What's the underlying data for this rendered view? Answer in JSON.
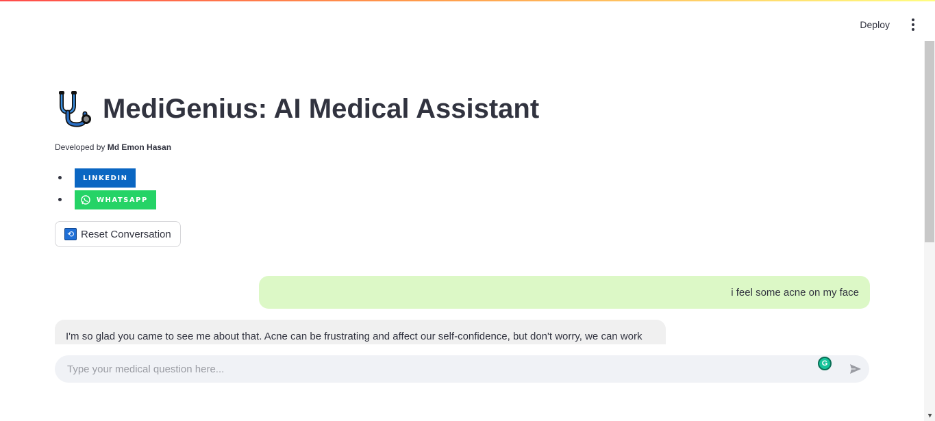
{
  "header": {
    "deploy_label": "Deploy",
    "menu_icon": "more-vertical-icon"
  },
  "app": {
    "title": "MediGenius: AI Medical Assistant",
    "title_icon": "stethoscope-icon",
    "developer_prefix": "Developed by ",
    "developer_name": "Md Emon Hasan"
  },
  "links": [
    {
      "label": "LINKEDIN",
      "color": "#0a66c2"
    },
    {
      "label": "WHATSAPP",
      "color": "#25d366",
      "icon": "whatsapp-icon"
    }
  ],
  "reset_button": {
    "label": "Reset Conversation",
    "icon": "repeat-icon"
  },
  "chat": {
    "messages": [
      {
        "role": "user",
        "text": "i feel some acne on my face"
      },
      {
        "role": "assistant",
        "text": "I'm so glad you came to see me about that. Acne can be frustrating and affect our self-confidence, but don't worry, we can work"
      }
    ],
    "user_bubble_color": "#dcf8c6",
    "assistant_bubble_color": "#f0f0f0"
  },
  "chat_input": {
    "placeholder": "Type your medical question here...",
    "value": "",
    "grammarly_letter": "G",
    "send_icon": "send-icon"
  }
}
